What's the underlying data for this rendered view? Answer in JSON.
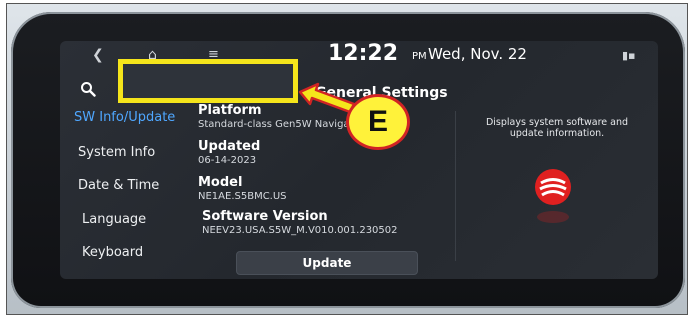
{
  "status_bar": {
    "time": "12:22",
    "ampm": "PM",
    "date": "Wed, Nov. 22"
  },
  "sidebar": {
    "items": [
      {
        "label": "SW Info/Update",
        "active": true
      },
      {
        "label": "System Info"
      },
      {
        "label": "Date & Time"
      },
      {
        "label": "Language"
      },
      {
        "label": "Keyboard"
      }
    ]
  },
  "panel": {
    "title": "General Settings",
    "rows": [
      {
        "title": "Platform",
        "value": "Standard-class Gen5W Navigation"
      },
      {
        "title": "Updated",
        "value": "06-14-2023"
      },
      {
        "title": "Model",
        "value": "NE1AE.S5BMC.US"
      },
      {
        "title": "Software Version",
        "value": "NEEV23.USA.S5W_M.V010.001.230502"
      }
    ],
    "update_label": "Update",
    "info_text": "Displays system software and update information."
  },
  "annotation": {
    "label": "E",
    "box_color": "#f5e51b",
    "badge_color": "#fff23a",
    "arrow_color": "#d12424"
  },
  "colors": {
    "active_item": "#4fa7ff",
    "screen_bg": "#2b2f36"
  }
}
